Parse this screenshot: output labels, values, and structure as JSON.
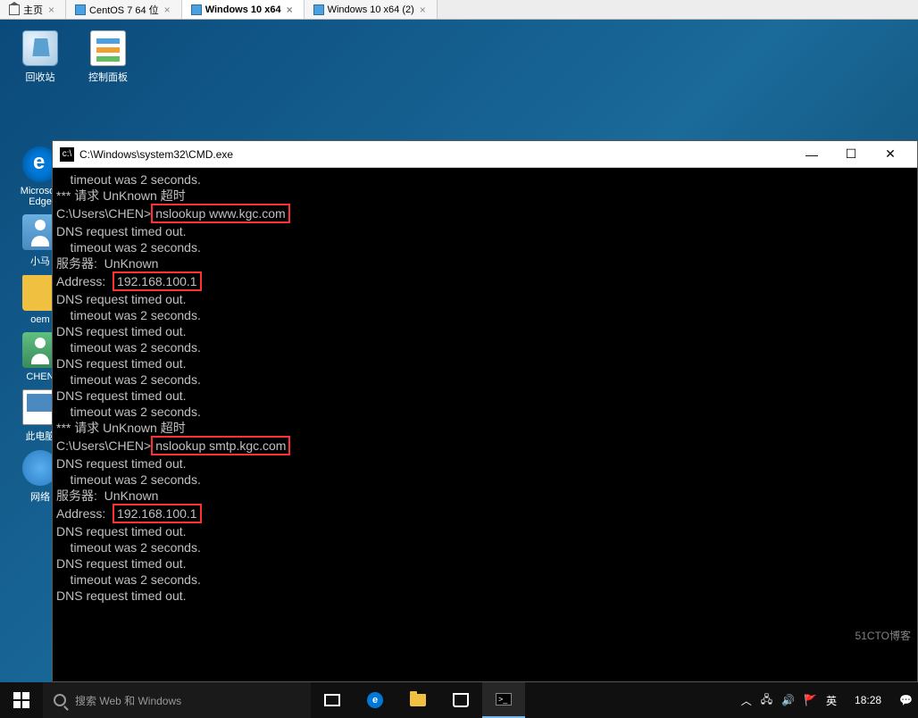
{
  "vmTabs": {
    "home": "主页",
    "tab1": "CentOS 7 64 位",
    "tab2": "Windows 10 x64",
    "tab3": "Windows 10 x64 (2)"
  },
  "desktop": {
    "recycle": "回收站",
    "control": "控制面板",
    "edge": "Microsoft Edge",
    "xiaoma": "小马",
    "oem": "oem",
    "chen": "CHEN",
    "pc": "此电脑",
    "net": "网络"
  },
  "cmd": {
    "title": "C:\\Windows\\system32\\CMD.exe",
    "l01": "    timeout was 2 seconds.",
    "l02a": "*** 请求 UnKnown 超时",
    "l03": "",
    "l04a": "C:\\Users\\CHEN>",
    "l04b": "nslookup www.kgc.com",
    "l05": "DNS request timed out.",
    "l06": "    timeout was 2 seconds.",
    "l07": "服务器:  UnKnown",
    "l08a": "Address:  ",
    "l08b": "192.168.100.1",
    "l09": "",
    "l10": "DNS request timed out.",
    "l11": "    timeout was 2 seconds.",
    "l12": "DNS request timed out.",
    "l13": "    timeout was 2 seconds.",
    "l14": "DNS request timed out.",
    "l15": "    timeout was 2 seconds.",
    "l16": "DNS request timed out.",
    "l17": "    timeout was 2 seconds.",
    "l18": "*** 请求 UnKnown 超时",
    "l19": "",
    "l20a": "C:\\Users\\CHEN>",
    "l20b": "nslookup smtp.kgc.com",
    "l21": "DNS request timed out.",
    "l22": "    timeout was 2 seconds.",
    "l23": "服务器:  UnKnown",
    "l24a": "Address:  ",
    "l24b": "192.168.100.1",
    "l25": "",
    "l26": "DNS request timed out.",
    "l27": "    timeout was 2 seconds.",
    "l28": "DNS request timed out.",
    "l29": "    timeout was 2 seconds.",
    "l30": "DNS request timed out."
  },
  "taskbar": {
    "search": "搜索 Web 和 Windows",
    "time": "18:28",
    "ime": "英",
    "chevron": "︿",
    "watermark": "51CTO博客"
  }
}
